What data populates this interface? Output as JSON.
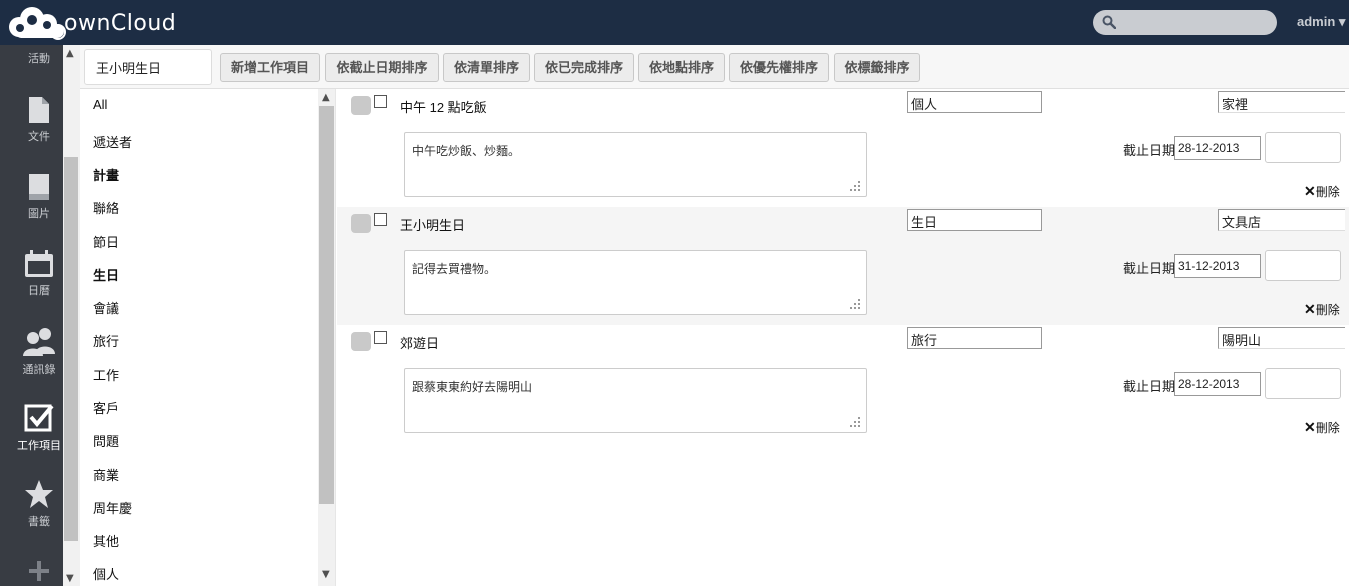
{
  "header": {
    "logo_text": "ownCloud",
    "user_label": "admin ▾",
    "search_placeholder": ""
  },
  "nav": {
    "items": [
      {
        "label": "活動",
        "icon": "activity-icon"
      },
      {
        "label": "文件",
        "icon": "file-icon"
      },
      {
        "label": "圖片",
        "icon": "picture-icon"
      },
      {
        "label": "日曆",
        "icon": "calendar-icon"
      },
      {
        "label": "通訊錄",
        "icon": "contacts-icon"
      },
      {
        "label": "工作項目",
        "icon": "tasks-icon",
        "active": true
      },
      {
        "label": "書籤",
        "icon": "star-icon"
      },
      {
        "label": "",
        "icon": "plus-icon"
      }
    ]
  },
  "controls": {
    "task_input_value": "王小明生日",
    "buttons": [
      "新增工作項目",
      "依截止日期排序",
      "依清單排序",
      "依已完成排序",
      "依地點排序",
      "依優先權排序",
      "依標籤排序"
    ]
  },
  "categories": [
    {
      "label": "All",
      "bold": false
    },
    {
      "label": "遞送者",
      "bold": false
    },
    {
      "label": "計畫",
      "bold": true
    },
    {
      "label": "聯絡",
      "bold": false
    },
    {
      "label": "節日",
      "bold": false
    },
    {
      "label": "生日",
      "bold": true
    },
    {
      "label": "會議",
      "bold": false
    },
    {
      "label": "旅行",
      "bold": false
    },
    {
      "label": "工作",
      "bold": false
    },
    {
      "label": "客戶",
      "bold": false
    },
    {
      "label": "問題",
      "bold": false
    },
    {
      "label": "商業",
      "bold": false
    },
    {
      "label": "周年慶",
      "bold": false
    },
    {
      "label": "其他",
      "bold": false
    },
    {
      "label": "個人",
      "bold": false
    }
  ],
  "tasks": [
    {
      "summary": "中午 12 點吃飯",
      "category": "個人",
      "location": "家裡",
      "note": "中午吃炒飯、炒麵。",
      "due_label": "截止日期",
      "due": "28-12-2013",
      "delete_label": "刪除"
    },
    {
      "summary": "王小明生日",
      "category": "生日",
      "location": "文具店",
      "note": "記得去買禮物。",
      "due_label": "截止日期",
      "due": "31-12-2013",
      "delete_label": "刪除"
    },
    {
      "summary": "郊遊日",
      "category": "旅行",
      "location": "陽明山",
      "note": "跟蔡東東約好去陽明山",
      "due_label": "截止日期",
      "due": "28-12-2013",
      "delete_label": "刪除"
    }
  ]
}
